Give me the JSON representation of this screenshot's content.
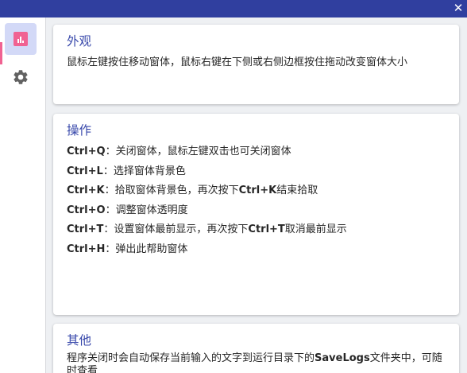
{
  "window": {
    "close_glyph": "✕"
  },
  "sidebar": {
    "items": [
      {
        "icon": "bar-chart-icon",
        "active": true
      },
      {
        "icon": "gear-icon",
        "active": false
      }
    ],
    "accent_color": "#f06292"
  },
  "cards": {
    "appearance": {
      "title": "外观",
      "text": "鼠标左键按住移动窗体，鼠标右键在下侧或右侧边框按住拖动改变窗体大小"
    },
    "operations": {
      "title": "操作",
      "items": [
        {
          "key": "Ctrl+Q",
          "desc": "：关闭窗体，鼠标左键双击也可关闭窗体"
        },
        {
          "key": "Ctrl+L",
          "desc": "：选择窗体背景色"
        },
        {
          "key": "Ctrl+K",
          "desc": "：拾取窗体背景色，再次按下",
          "key2": "Ctrl+K",
          "desc2": "结束拾取"
        },
        {
          "key": "Ctrl+O",
          "desc": "：调整窗体透明度"
        },
        {
          "key": "Ctrl+T",
          "desc": "：设置窗体最前显示，再次按下",
          "key2": "Ctrl+T",
          "desc2": "取消最前显示"
        },
        {
          "key": "Ctrl+H",
          "desc": "：弹出此帮助窗体"
        }
      ]
    },
    "other": {
      "title": "其他",
      "text_before": "程序关闭时会自动保存当前输入的文字到运行目录下的",
      "text_bold": "SaveLogs",
      "text_after": "文件夹中，可随时查看"
    }
  },
  "colors": {
    "titlebar": "#303f9f",
    "title_text": "#3949ab",
    "active_nav": "#d3d9f7"
  }
}
